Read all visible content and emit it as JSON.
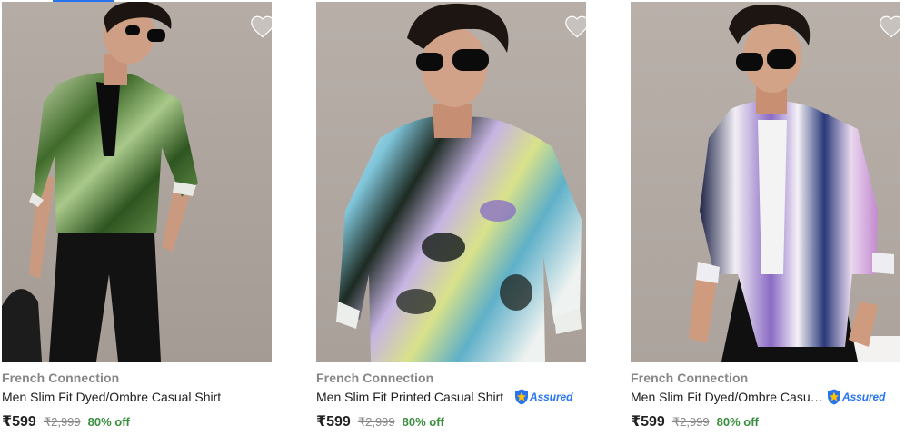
{
  "products": [
    {
      "brand": "French Connection",
      "title": "Men Slim Fit Dyed/Ombre Casual Shirt",
      "price": "₹599",
      "mrp": "₹2,999",
      "discount": "80% off",
      "assured": false,
      "assured_label": "",
      "image_icon": "product-photo-green-ombre-shirt"
    },
    {
      "brand": "French Connection",
      "title": "Men Slim Fit Printed Casual Shirt",
      "price": "₹599",
      "mrp": "₹2,999",
      "discount": "80% off",
      "assured": true,
      "assured_label": "Assured",
      "image_icon": "product-photo-printed-shirt"
    },
    {
      "brand": "French Connection",
      "title": "Men Slim Fit Dyed/Ombre Casua...",
      "price": "₹599",
      "mrp": "₹2,999",
      "discount": "80% off",
      "assured": true,
      "assured_label": "Assured",
      "image_icon": "product-photo-blue-ombre-shirt"
    }
  ],
  "colors": {
    "brand_text": "#878787",
    "title_text": "#212121",
    "discount": "#388e3c",
    "assured": "#2874f0",
    "wishlist_icon": "#c2c2c2",
    "image_bg": "#b3a9a3"
  }
}
